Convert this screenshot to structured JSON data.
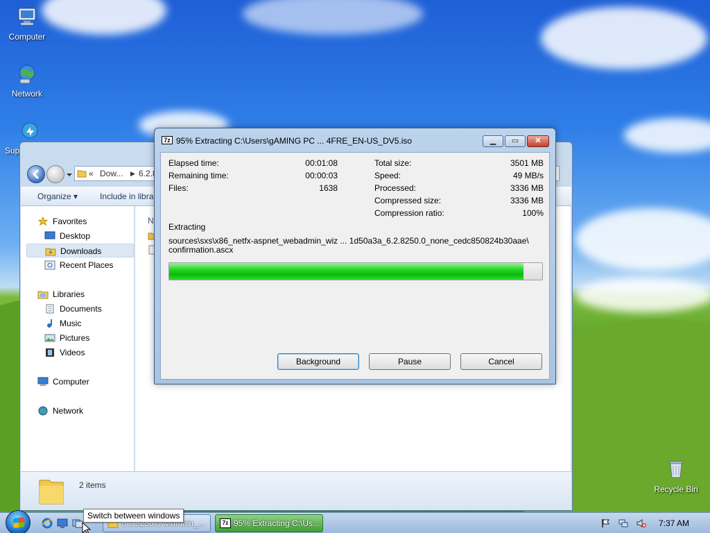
{
  "desktop": {
    "icons": [
      {
        "label": "Computer"
      },
      {
        "label": "Network"
      },
      {
        "label": "Sup"
      },
      {
        "label": "Recycle Bin"
      }
    ]
  },
  "explorer": {
    "address_prefix": "«",
    "address_part1": "Dow...",
    "address_part2": "6.2.8",
    "toolbar": {
      "organize": "Organize",
      "include": "Include in libra"
    },
    "nav": {
      "favorites": "Favorites",
      "desktop": "Desktop",
      "downloads": "Downloads",
      "recent": "Recent Places",
      "libraries": "Libraries",
      "documents": "Documents",
      "music": "Music",
      "pictures": "Pictures",
      "videos": "Videos",
      "computer": "Computer",
      "network": "Network"
    },
    "column_header_fragment": "N",
    "details": {
      "count": "2 items"
    }
  },
  "dialog": {
    "title": "95% Extracting C:\\Users\\gAMING PC ... 4FRE_EN-US_DV5.iso",
    "title_icon": "7z",
    "stats_left": [
      {
        "label": "Elapsed time:",
        "value": "00:01:08"
      },
      {
        "label": "Remaining time:",
        "value": "00:00:03"
      },
      {
        "label": "Files:",
        "value": "1638"
      }
    ],
    "stats_right": [
      {
        "label": "Total size:",
        "value": "3501 MB"
      },
      {
        "label": "Speed:",
        "value": "49 MB/s"
      },
      {
        "label": "Processed:",
        "value": "3336 MB"
      },
      {
        "label": "Compressed size:",
        "value": "3336 MB"
      },
      {
        "label": "Compression ratio:",
        "value": "100%"
      }
    ],
    "operation": "Extracting",
    "path_line1": "sources\\sxs\\x86_netfx-aspnet_webadmin_wiz ... 1d50a3a_6.2.8250.0_none_cedc850824b30aae\\",
    "path_line2": "confirmation.ascx",
    "progress_fraction": 0.95,
    "buttons": {
      "background": "Background",
      "pause": "Pause",
      "cancel": "Cancel"
    }
  },
  "taskbar": {
    "tooltip": "Switch between windows",
    "tasks": [
      {
        "label": "6.2.8250.0.winmain_..."
      },
      {
        "label": "95% Extracting C:\\Us..."
      }
    ],
    "clock": "7:37 AM"
  },
  "colors": {
    "progress_green": "#20d820",
    "window_frame": "#bcd3ec",
    "close_red": "#c0412b"
  }
}
